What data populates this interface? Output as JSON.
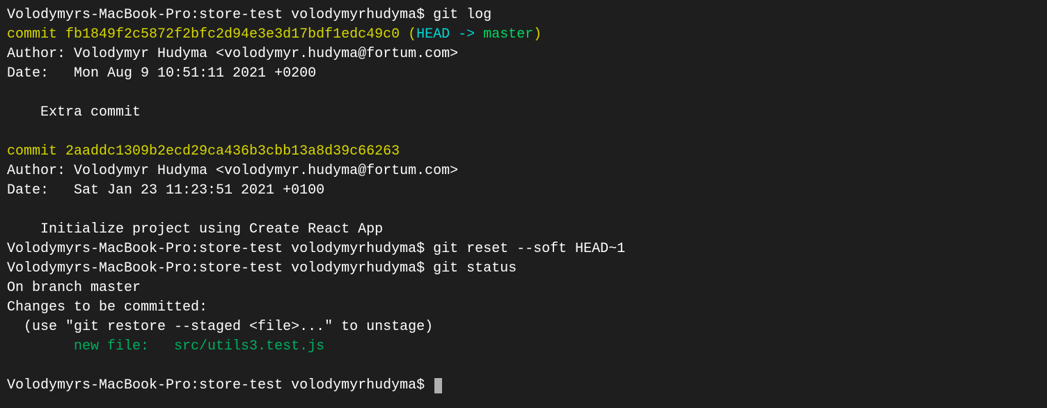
{
  "lines": {
    "l1_prompt": "Volodymyrs-MacBook-Pro:store-test volodymyrhudyma$ ",
    "l1_cmd": "git log",
    "l2_commit": "commit fb1849f2c5872f2bfc2d94e3e3d17bdf1edc49c0 (",
    "l2_head": "HEAD -> ",
    "l2_branch": "master",
    "l2_close": ")",
    "l3": "Author: Volodymyr Hudyma <volodymyr.hudyma@fortum.com>",
    "l4": "Date:   Mon Aug 9 10:51:11 2021 +0200",
    "l5": "",
    "l6": "    Extra commit",
    "l7": "",
    "l8": "commit 2aaddc1309b2ecd29ca436b3cbb13a8d39c66263",
    "l9": "Author: Volodymyr Hudyma <volodymyr.hudyma@fortum.com>",
    "l10": "Date:   Sat Jan 23 11:23:51 2021 +0100",
    "l11": "",
    "l12": "    Initialize project using Create React App",
    "l13_prompt": "Volodymyrs-MacBook-Pro:store-test volodymyrhudyma$ ",
    "l13_cmd": "git reset --soft HEAD~1",
    "l14_prompt": "Volodymyrs-MacBook-Pro:store-test volodymyrhudyma$ ",
    "l14_cmd": "git status",
    "l15": "On branch master",
    "l16": "Changes to be committed:",
    "l17": "  (use \"git restore --staged <file>...\" to unstage)",
    "l18": "        new file:   src/utils3.test.js",
    "l19": "",
    "l20_prompt": "Volodymyrs-MacBook-Pro:store-test volodymyrhudyma$ "
  }
}
